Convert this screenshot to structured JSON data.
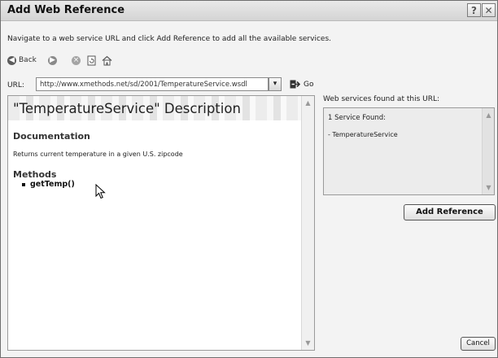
{
  "window": {
    "title": "Add Web Reference",
    "help_button": "?",
    "close_button": "✕"
  },
  "instruction": "Navigate to a web service URL and click Add Reference to add all the available services.",
  "toolbar": {
    "back_label": "Back"
  },
  "url": {
    "label": "URL:",
    "value": "http://www.xmethods.net/sd/2001/TemperatureService.wsdl",
    "dropdown_glyph": "▾",
    "go_label": "Go"
  },
  "browser": {
    "title": "\"TemperatureService\" Description",
    "documentation_heading": "Documentation",
    "documentation_text": "Returns current temperature in a given U.S. zipcode",
    "methods_heading": "Methods",
    "methods": [
      "getTemp()"
    ]
  },
  "services_panel": {
    "label": "Web services found at this URL:",
    "count_text": "1 Service Found:",
    "items": [
      "- TemperatureService"
    ]
  },
  "buttons": {
    "add_reference": "Add Reference",
    "cancel": "Cancel"
  }
}
